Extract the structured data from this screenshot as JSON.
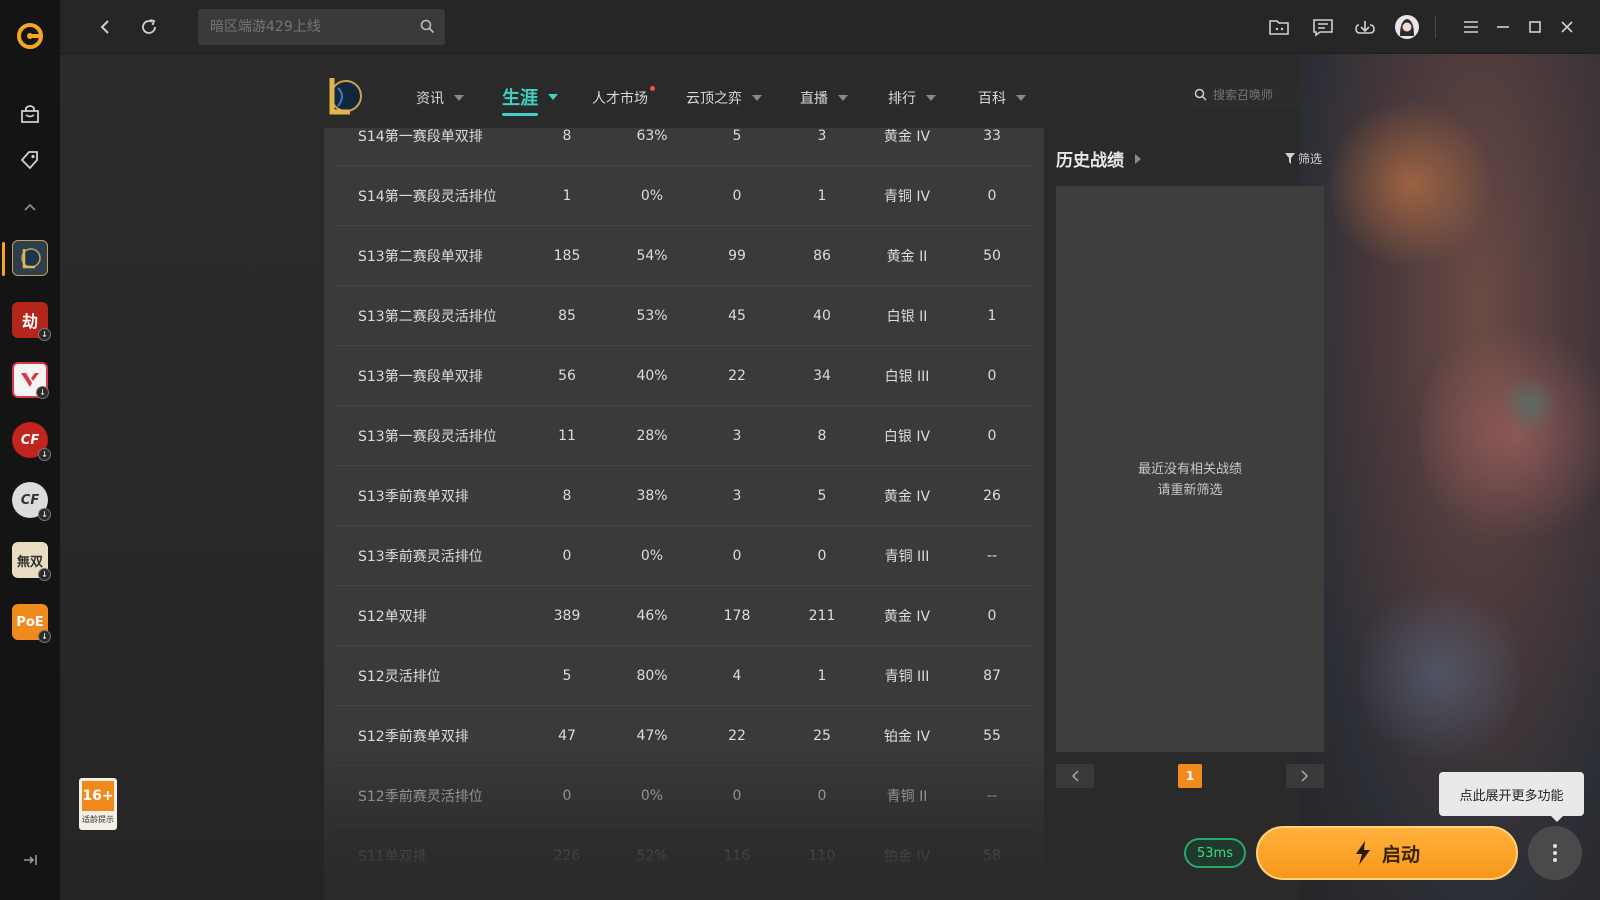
{
  "search": {
    "placeholder": "暗区端游429上线"
  },
  "nav": {
    "items": [
      {
        "label": "资讯"
      },
      {
        "label": "生涯"
      },
      {
        "label": "人才市场"
      },
      {
        "label": "云顶之弈"
      },
      {
        "label": "直播"
      },
      {
        "label": "排行"
      },
      {
        "label": "百科"
      }
    ],
    "summoner_search_placeholder": "搜索召唤师"
  },
  "table": {
    "rows": [
      {
        "season": "S14第一赛段单双排",
        "games": "8",
        "winrate": "63%",
        "wins": "5",
        "losses": "3",
        "rank": "黄金 IV",
        "points": "33"
      },
      {
        "season": "S14第一赛段灵活排位",
        "games": "1",
        "winrate": "0%",
        "wins": "0",
        "losses": "1",
        "rank": "青铜 IV",
        "points": "0"
      },
      {
        "season": "S13第二赛段单双排",
        "games": "185",
        "winrate": "54%",
        "wins": "99",
        "losses": "86",
        "rank": "黄金 II",
        "points": "50"
      },
      {
        "season": "S13第二赛段灵活排位",
        "games": "85",
        "winrate": "53%",
        "wins": "45",
        "losses": "40",
        "rank": "白银 II",
        "points": "1"
      },
      {
        "season": "S13第一赛段单双排",
        "games": "56",
        "winrate": "40%",
        "wins": "22",
        "losses": "34",
        "rank": "白银 III",
        "points": "0"
      },
      {
        "season": "S13第一赛段灵活排位",
        "games": "11",
        "winrate": "28%",
        "wins": "3",
        "losses": "8",
        "rank": "白银 IV",
        "points": "0"
      },
      {
        "season": "S13季前赛单双排",
        "games": "8",
        "winrate": "38%",
        "wins": "3",
        "losses": "5",
        "rank": "黄金 IV",
        "points": "26"
      },
      {
        "season": "S13季前赛灵活排位",
        "games": "0",
        "winrate": "0%",
        "wins": "0",
        "losses": "0",
        "rank": "青铜 III",
        "points": "--"
      },
      {
        "season": "S12单双排",
        "games": "389",
        "winrate": "46%",
        "wins": "178",
        "losses": "211",
        "rank": "黄金 IV",
        "points": "0"
      },
      {
        "season": "S12灵活排位",
        "games": "5",
        "winrate": "80%",
        "wins": "4",
        "losses": "1",
        "rank": "青铜 III",
        "points": "87"
      },
      {
        "season": "S12季前赛单双排",
        "games": "47",
        "winrate": "47%",
        "wins": "22",
        "losses": "25",
        "rank": "铂金 IV",
        "points": "55"
      },
      {
        "season": "S12季前赛灵活排位",
        "games": "0",
        "winrate": "0%",
        "wins": "0",
        "losses": "0",
        "rank": "青铜 II",
        "points": "--"
      },
      {
        "season": "S11单双排",
        "games": "226",
        "winrate": "52%",
        "wins": "116",
        "losses": "110",
        "rank": "铂金 IV",
        "points": "58"
      }
    ]
  },
  "history": {
    "title": "历史战绩",
    "filter_label": "筛选",
    "empty_line1": "最近没有相关战绩",
    "empty_line2": "请重新筛选",
    "current_page": "1"
  },
  "tooltip": "点此展开更多功能",
  "ping": "53ms",
  "launch_label": "启动",
  "age_badge": {
    "rating": "16+",
    "note": "适龄提示"
  },
  "colors": {
    "accent": "#3fd2c4",
    "launch": "#f7961a",
    "ping": "#2aa86a"
  }
}
